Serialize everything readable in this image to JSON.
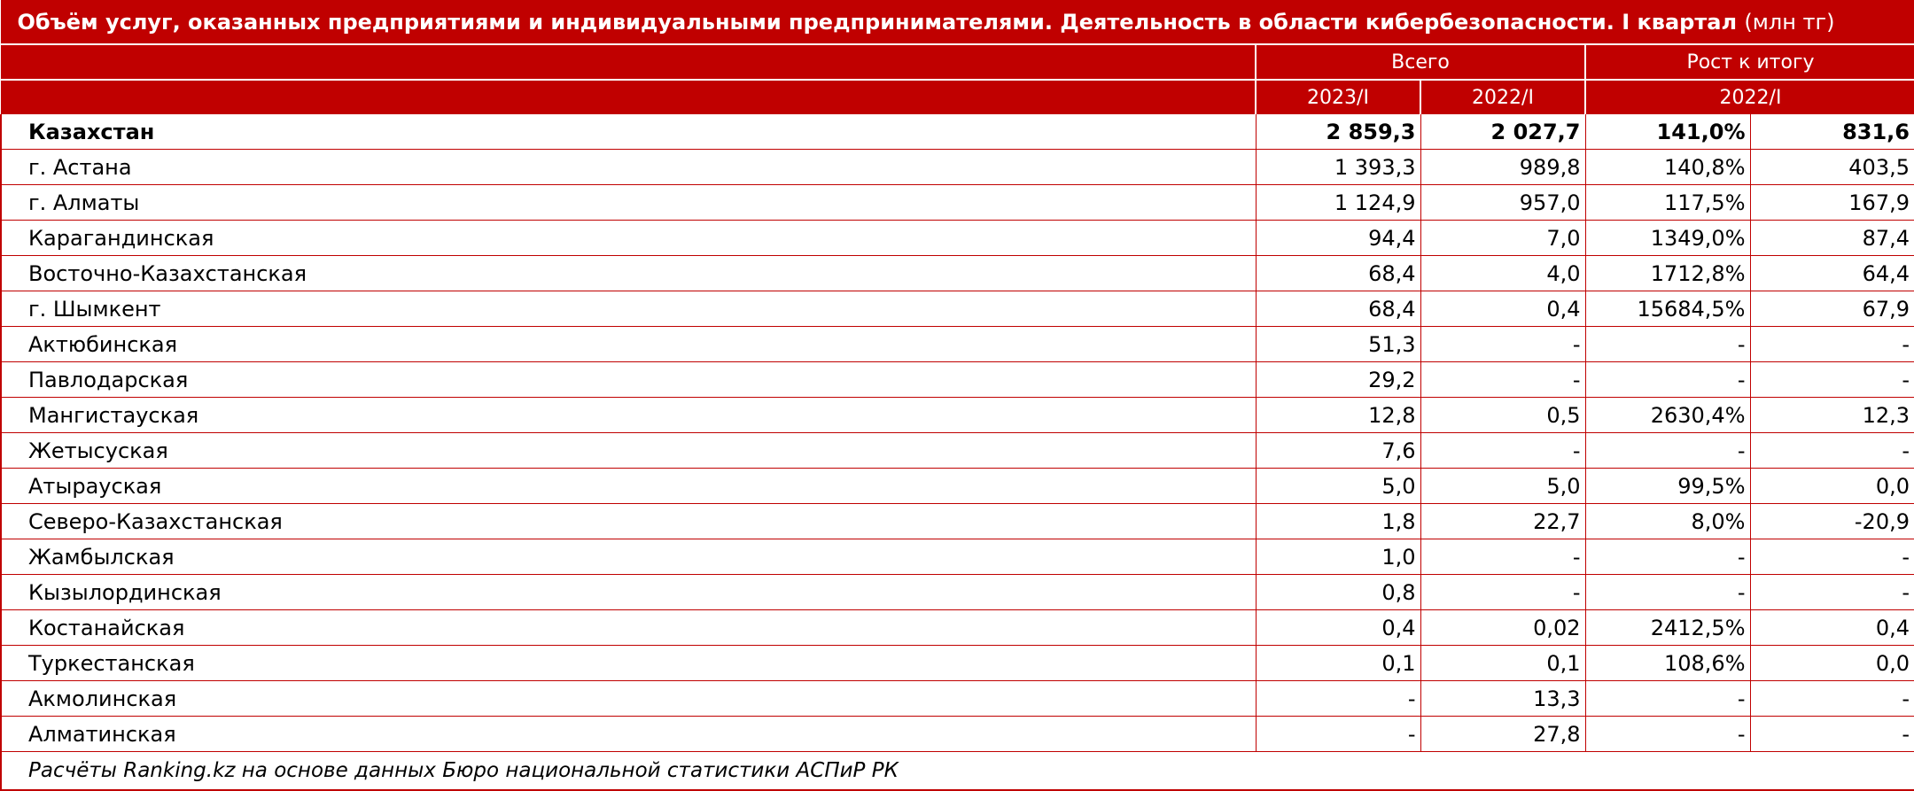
{
  "title": "Объём услуг, оказанных предприятиями и индивидуальными предпринимателями. Деятельность в области кибербезопасности. I квартал",
  "unit": "(млн тг)",
  "header": {
    "total": "Всего",
    "growth": "Рост к итогу",
    "y2023": "2023/I",
    "y2022": "2022/I",
    "growth_year": "2022/I"
  },
  "rows": [
    {
      "name": "Казахстан",
      "v2023": "2 859,3",
      "v2022": "2 027,7",
      "pct": "141,0%",
      "abs": "831,6"
    },
    {
      "name": "г. Астана",
      "v2023": "1 393,3",
      "v2022": "989,8",
      "pct": "140,8%",
      "abs": "403,5"
    },
    {
      "name": "г. Алматы",
      "v2023": "1 124,9",
      "v2022": "957,0",
      "pct": "117,5%",
      "abs": "167,9"
    },
    {
      "name": "Карагандинская",
      "v2023": "94,4",
      "v2022": "7,0",
      "pct": "1349,0%",
      "abs": "87,4"
    },
    {
      "name": "Восточно-Казахстанская",
      "v2023": "68,4",
      "v2022": "4,0",
      "pct": "1712,8%",
      "abs": "64,4"
    },
    {
      "name": "г. Шымкент",
      "v2023": "68,4",
      "v2022": "0,4",
      "pct": "15684,5%",
      "abs": "67,9"
    },
    {
      "name": "Актюбинская",
      "v2023": "51,3",
      "v2022": "-",
      "pct": "-",
      "abs": "-"
    },
    {
      "name": "Павлодарская",
      "v2023": "29,2",
      "v2022": "-",
      "pct": "-",
      "abs": "-"
    },
    {
      "name": "Мангистауская",
      "v2023": "12,8",
      "v2022": "0,5",
      "pct": "2630,4%",
      "abs": "12,3"
    },
    {
      "name": "Жетысуская",
      "v2023": "7,6",
      "v2022": "-",
      "pct": "-",
      "abs": "-"
    },
    {
      "name": "Атырауская",
      "v2023": "5,0",
      "v2022": "5,0",
      "pct": "99,5%",
      "abs": "0,0"
    },
    {
      "name": "Северо-Казахстанская",
      "v2023": "1,8",
      "v2022": "22,7",
      "pct": "8,0%",
      "abs": "-20,9"
    },
    {
      "name": "Жамбылская",
      "v2023": "1,0",
      "v2022": "-",
      "pct": "-",
      "abs": "-"
    },
    {
      "name": "Кызылординская",
      "v2023": "0,8",
      "v2022": "-",
      "pct": "-",
      "abs": "-"
    },
    {
      "name": "Костанайская",
      "v2023": "0,4",
      "v2022": "0,02",
      "pct": "2412,5%",
      "abs": "0,4"
    },
    {
      "name": "Туркестанская",
      "v2023": "0,1",
      "v2022": "0,1",
      "pct": "108,6%",
      "abs": "0,0"
    },
    {
      "name": "Акмолинская",
      "v2023": "-",
      "v2022": "13,3",
      "pct": "-",
      "abs": "-"
    },
    {
      "name": "Алматинская",
      "v2023": "-",
      "v2022": "27,8",
      "pct": "-",
      "abs": "-"
    }
  ],
  "footer": "Расчёты Ranking.kz на основе данных Бюро национальной статистики АСПиР РК"
}
